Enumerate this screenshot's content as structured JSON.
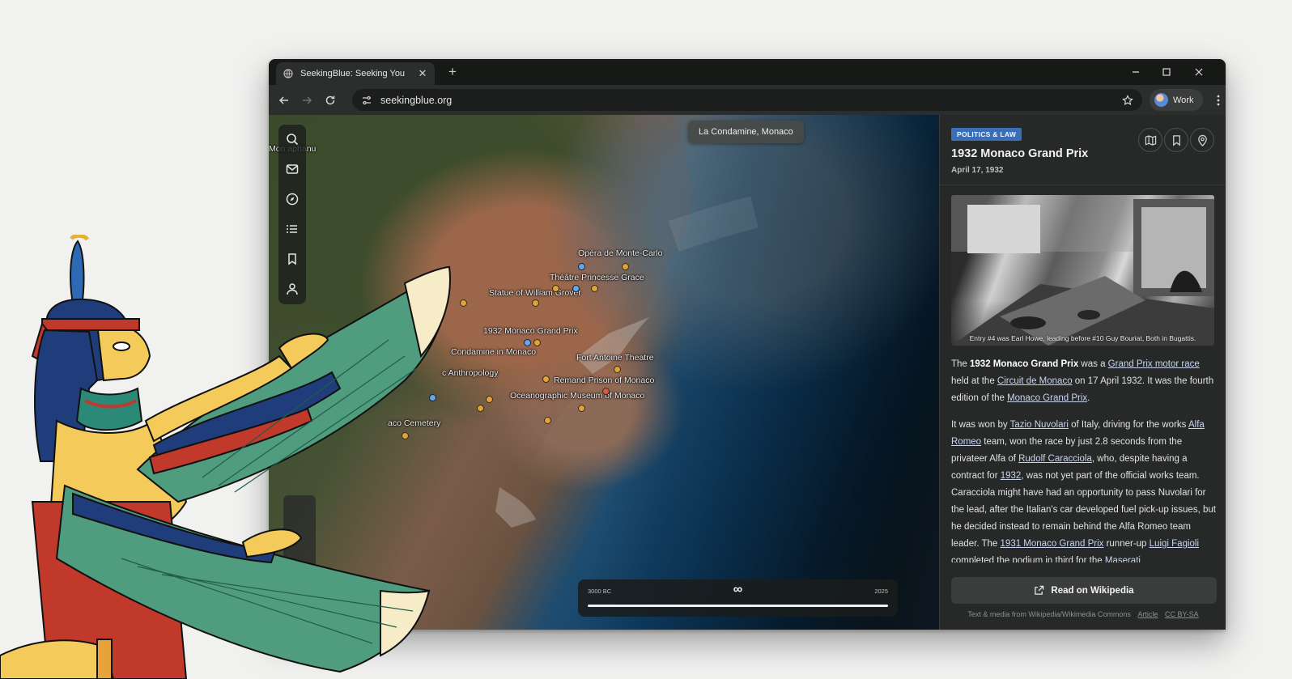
{
  "browser": {
    "tab_title": "SeekingBlue: Seeking You",
    "url": "seekingblue.org",
    "profile_label": "Work"
  },
  "map": {
    "location_label": "La Condamine, Monaco",
    "labels": [
      {
        "id": "opera",
        "text": "Opéra de Monte-Carlo"
      },
      {
        "id": "theatre-grace",
        "text": "Théâtre Princesse Grace"
      },
      {
        "id": "statue",
        "text": "Statue of William Grover"
      },
      {
        "id": "grandprix",
        "text": "1932 Monaco Grand Prix"
      },
      {
        "id": "condamine",
        "text": "Condamine in Monaco"
      },
      {
        "id": "fort",
        "text": "Fort Antoine Theatre"
      },
      {
        "id": "anthropology",
        "text": "c Anthropology"
      },
      {
        "id": "prison",
        "text": "Remand Prison of Monaco"
      },
      {
        "id": "oceano",
        "text": "Oceanographic Museum of Monaco"
      },
      {
        "id": "cemetery",
        "text": "aco Cemetery"
      },
      {
        "id": "aphanu",
        "text": "Mon aphanu"
      }
    ],
    "timeline": {
      "start": "3000 BC",
      "end": "2025",
      "symbol": "∞"
    }
  },
  "panel": {
    "category": "POLITICS & LAW",
    "title": "1932 Monaco Grand Prix",
    "date": "April 17, 1932",
    "image_caption": "Entry #4 was Earl Howe, leading before #10 Guy Bouriat, Both in Bugattis.",
    "para1": {
      "t1": "The ",
      "b1": "1932 Monaco Grand Prix",
      "t2": " was a ",
      "l1": "Grand Prix motor race",
      "t3": " held at the ",
      "l2": "Circuit de Monaco",
      "t4": " on 17 April 1932. It was the fourth edition of the ",
      "l3": "Monaco Grand Prix",
      "t5": "."
    },
    "para2": {
      "t1": "It was won by ",
      "l1": "Tazio Nuvolari",
      "t2": " of Italy, driving for the works ",
      "l2": "Alfa Romeo",
      "t3": " team, won the race by just 2.8 seconds from the privateer Alfa of ",
      "l3": "Rudolf Caracciola",
      "t4": ", who, despite having a contract for ",
      "l4": "1932",
      "t5": ", was not yet part of the official works team. Caracciola might have had an opportunity to pass Nuvolari for the lead, after the Italian's car developed fuel pick-up issues, but he decided instead to remain behind the Alfa Romeo team leader. The ",
      "l5": "1931 Monaco Grand Prix",
      "t6": " runner-up ",
      "l6": "Luigi Fagioli",
      "t7": " completed the podium in third for the ",
      "l7": "Maserati"
    },
    "read_button": "Read on Wikipedia",
    "credits": {
      "text": "Text & media from Wikipedia/Wikimedia Commons",
      "article": "Article",
      "license": "CC BY-SA"
    }
  },
  "colors": {
    "category_badge": "#3a6fb8",
    "link": "#c9d4ef",
    "poi": "#e0a23a"
  }
}
